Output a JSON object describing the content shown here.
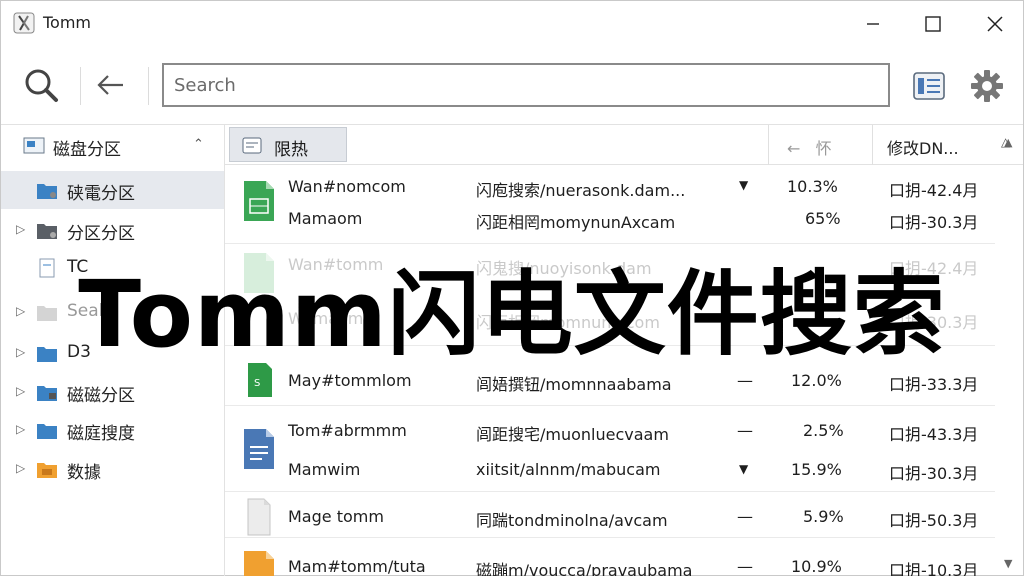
{
  "window": {
    "title": "Tomm"
  },
  "search": {
    "placeholder": "Search"
  },
  "sidebar": {
    "header": "磁盘分区",
    "items": [
      {
        "label": "硖電分区"
      },
      {
        "label": "分区分区"
      },
      {
        "label": "TC"
      },
      {
        "label": "Sealu"
      },
      {
        "label": "D3"
      },
      {
        "label": "磁磁分区"
      },
      {
        "label": "磁庭搜度"
      },
      {
        "label": "数據"
      }
    ]
  },
  "columns": {
    "name": "限热",
    "size": "←   怀",
    "modified": "修改DN..."
  },
  "rows": [
    {
      "name": "Wan#nomcom",
      "path": "闪庖搜索/nuerasonk.dam...",
      "pct": "10.3%",
      "date": "口抈-42.4月"
    },
    {
      "name": "Mamaom",
      "path": "闪距相罔momynunAxcam",
      "pct": "65%",
      "date": "口抈-30.3月"
    },
    {
      "name": "Wan#tomm",
      "path": "闪鬼搜/nuoyisonk.dam",
      "pct": "",
      "date": "口抈-42.4月"
    },
    {
      "name": "Wamaom",
      "path": "闪距相罔momnunk.com",
      "pct": "",
      "date": "口抈-30.3月"
    },
    {
      "name": "May#tommlom",
      "path": "闾娪撰钮/momnnaabama",
      "pct": "12.0%",
      "date": "口抈-33.3月"
    },
    {
      "name": "Tom#abrmmm",
      "path": "闾距搜宅/muonluecvaam",
      "pct": "2.5%",
      "date": "口抈-43.3月"
    },
    {
      "name": "Mamwim",
      "path": "xiitsit/alnnm/mabucam",
      "pct": "15.9%",
      "date": "口抈-30.3月"
    },
    {
      "name": "Mage tomm",
      "path": "同踹tondminolna/avcam",
      "pct": "5.9%",
      "date": "口抈-50.3月"
    },
    {
      "name": "Mam#tomm/tuta",
      "path": "磁蹦m/voucca/pravaubama",
      "pct": "10.9%",
      "date": "口抈-10.3月"
    }
  ],
  "overlay": {
    "title": "Tomm闪电文件搜索"
  },
  "colors": {
    "accent": "#3b82c4",
    "green": "#3aa655",
    "blue_doc": "#4a78b5",
    "orange": "#f0a030"
  }
}
